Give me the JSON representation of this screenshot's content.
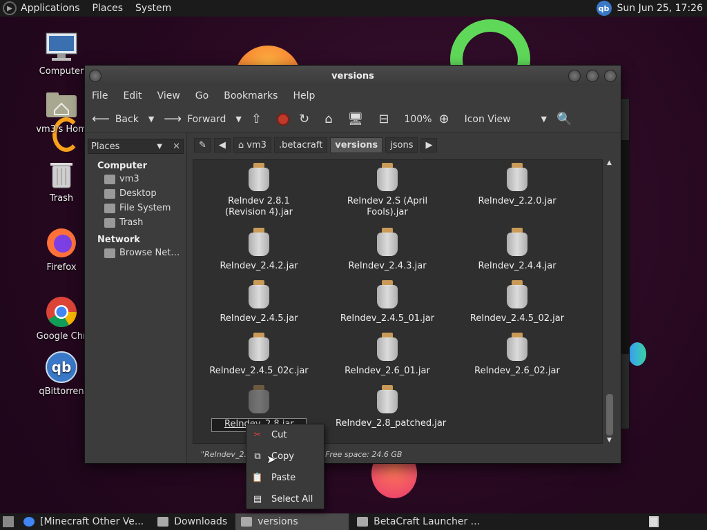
{
  "top_panel": {
    "menu": [
      "Applications",
      "Places",
      "System"
    ],
    "tray_label": "qb",
    "clock": "Sun Jun 25, 17:26"
  },
  "desktop_icons": [
    "Computer",
    "vm3's Hom",
    "Trash",
    "Firefox",
    "Google Chr",
    "qBittorren"
  ],
  "window": {
    "title": "versions",
    "menubar": [
      "File",
      "Edit",
      "View",
      "Go",
      "Bookmarks",
      "Help"
    ],
    "toolbar": {
      "back": "Back",
      "forward": "Forward",
      "zoom": "100%",
      "view_mode": "Icon View"
    },
    "sidebar": {
      "selector": "Places",
      "computer_header": "Computer",
      "computer_items": [
        "vm3",
        "Desktop",
        "File System",
        "Trash"
      ],
      "network_header": "Network",
      "network_items": [
        "Browse Net…"
      ]
    },
    "pathbar": [
      "vm3",
      ".betacraft",
      "versions",
      "jsons"
    ],
    "files": [
      "ReIndev 2.8.1 (Revision 4).jar",
      "ReIndev 2.S (April Fools).jar",
      "ReIndev_2.2.0.jar",
      "ReIndev_2.4.2.jar",
      "ReIndev_2.4.3.jar",
      "ReIndev_2.4.4.jar",
      "ReIndev_2.4.5.jar",
      "ReIndev_2.4.5_01.jar",
      "ReIndev_2.4.5_02.jar",
      "ReIndev_2.4.5_02c.jar",
      "ReIndev_2.6_01.jar",
      "ReIndev_2.6_02.jar",
      "ReIndev_2.8.jar",
      "ReIndev_2.8_patched.jar"
    ],
    "rename_value": "ReIndev_2.8.jar",
    "status": {
      "selection": "\"ReIndev_2.8",
      "free_space": "Free space: 24.6 GB"
    }
  },
  "context_menu": {
    "items": [
      "Cut",
      "Copy",
      "Paste",
      "Select All"
    ]
  },
  "taskbar": {
    "tasks": [
      "[Minecraft Other Ve...",
      "Downloads",
      "versions",
      "BetaCraft Launcher ..."
    ]
  }
}
